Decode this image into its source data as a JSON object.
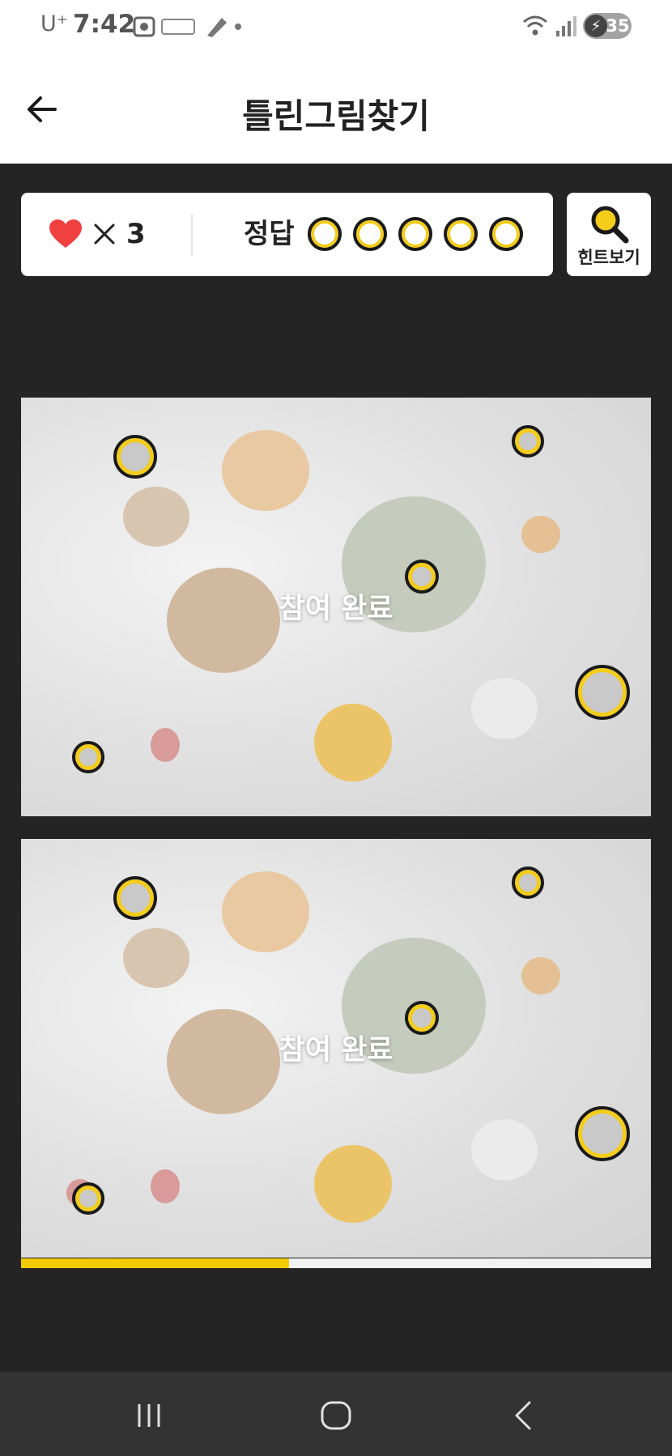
{
  "status_bar": {
    "carrier": "U⁺",
    "time": "7:42",
    "battery": "35"
  },
  "header": {
    "title": "틀린그림찾기"
  },
  "game_info": {
    "lives_count": "3",
    "answer_label": "정답",
    "answer_total": 5
  },
  "hint": {
    "label": "힌트보기"
  },
  "puzzles": [
    {
      "status_label": "참여 완료"
    },
    {
      "status_label": "참여 완료"
    }
  ],
  "progress": {
    "fraction": 0.425
  },
  "colors": {
    "accent": "#f2cc00",
    "background": "#242424",
    "heart": "#f04040"
  },
  "icons": [
    "back-arrow-icon",
    "heart-icon",
    "times-icon",
    "magnifier-icon",
    "recent-apps-icon",
    "home-icon",
    "nav-back-icon"
  ]
}
